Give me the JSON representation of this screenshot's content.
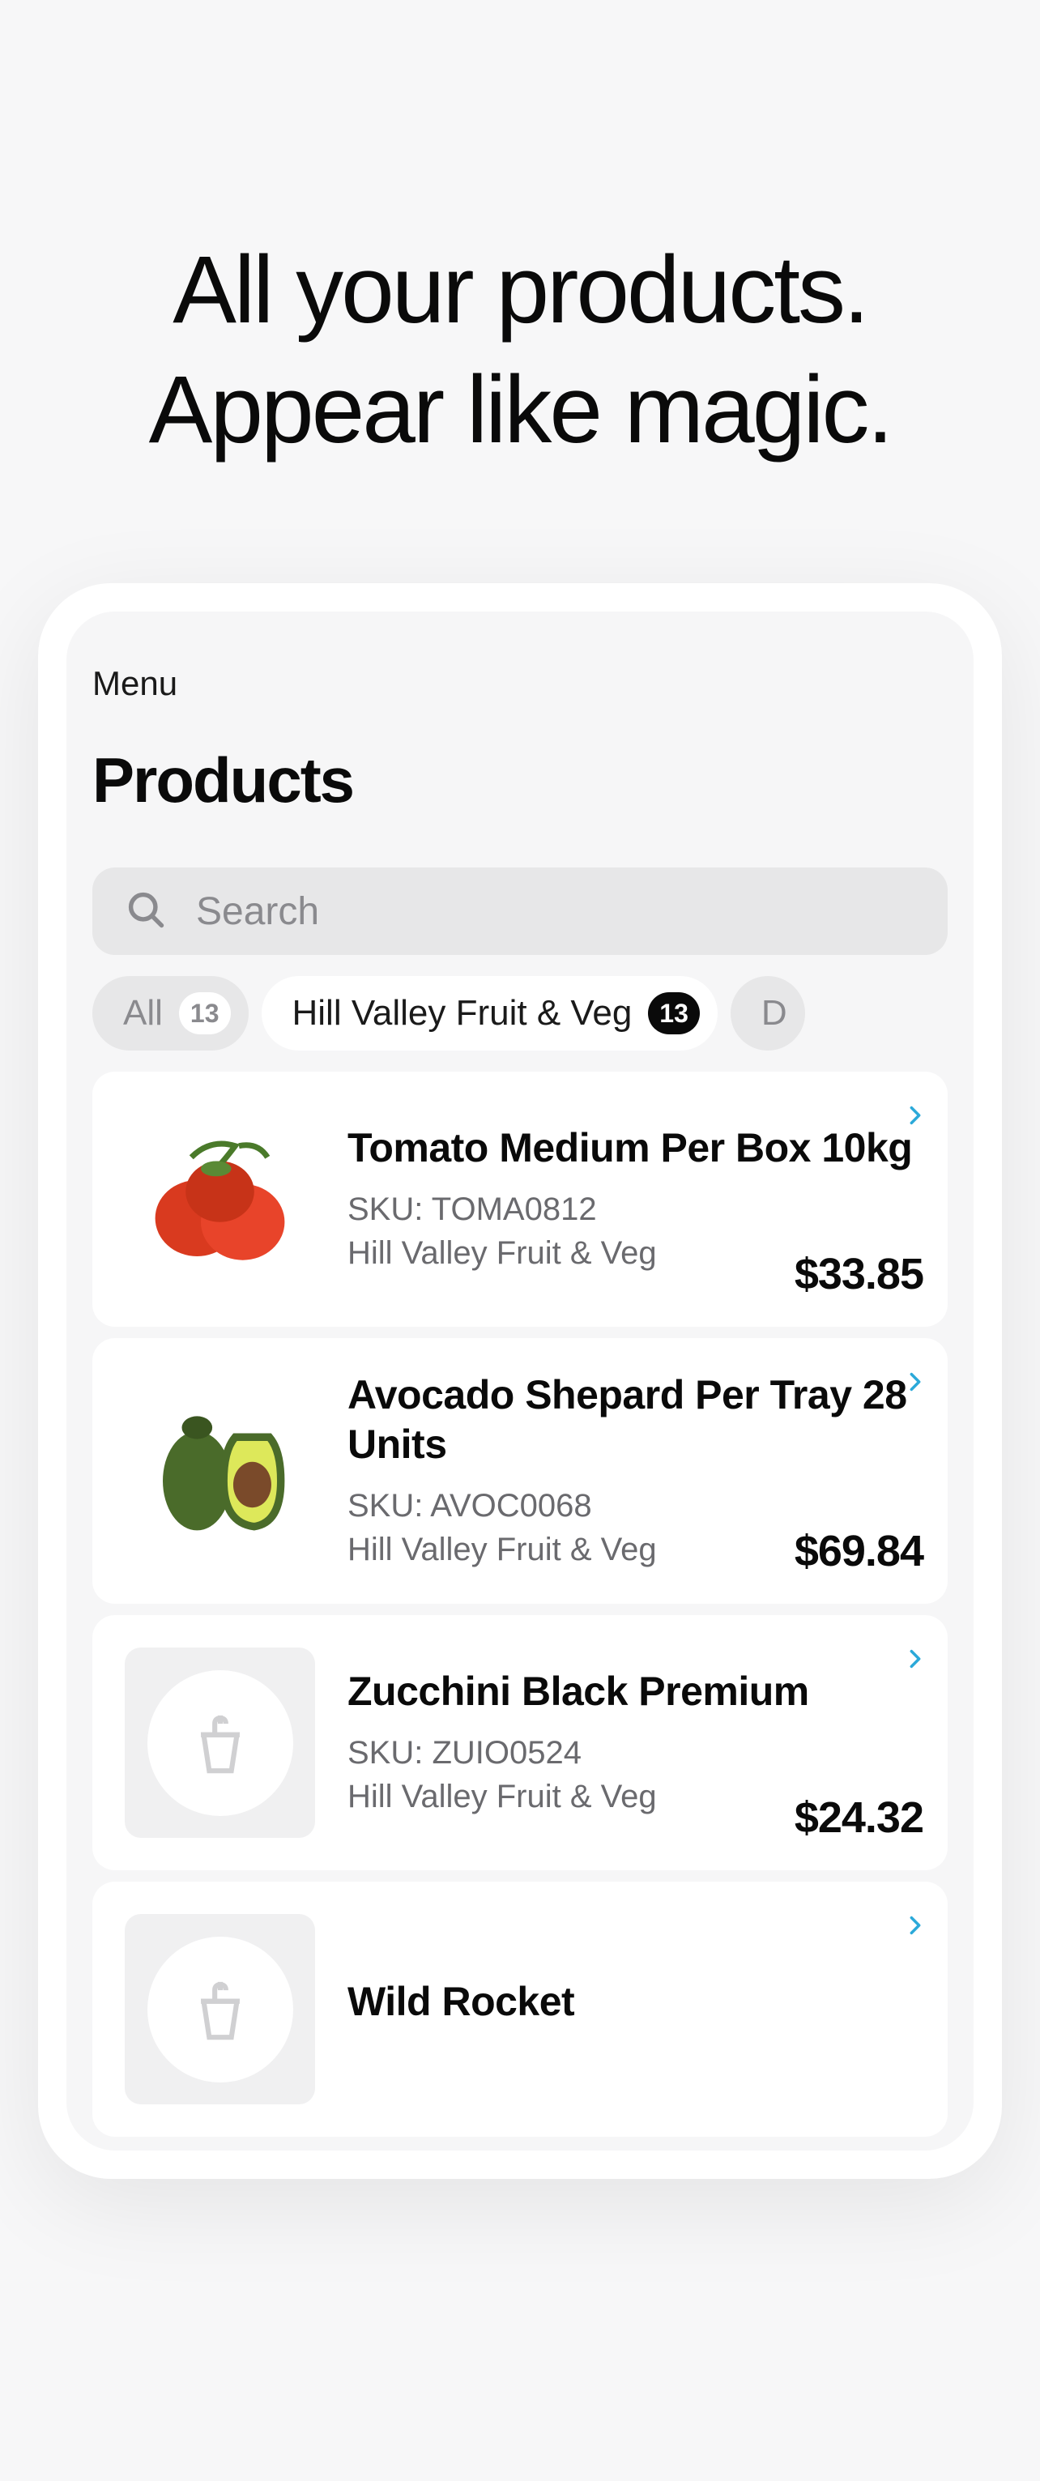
{
  "headline": {
    "line1": "All your products.",
    "line2": "Appear like magic."
  },
  "nav": {
    "menu": "Menu"
  },
  "page": {
    "title": "Products"
  },
  "search": {
    "placeholder": "Search"
  },
  "filters": [
    {
      "label": "All",
      "count": "13",
      "active": false
    },
    {
      "label": "Hill Valley Fruit & Veg",
      "count": "13",
      "active": true
    },
    {
      "label": "D",
      "count": "",
      "active": false
    }
  ],
  "products": [
    {
      "name": "Tomato Medium Per Box 10kg",
      "sku": "SKU: TOMA0812",
      "vendor": "Hill Valley Fruit & Veg",
      "price": "$33.85",
      "image": "tomato"
    },
    {
      "name": "Avocado Shepard Per Tray 28 Units",
      "sku": "SKU: AVOC0068",
      "vendor": "Hill Valley Fruit & Veg",
      "price": "$69.84",
      "image": "avocado"
    },
    {
      "name": "Zucchini Black Premium",
      "sku": "SKU: ZUIO0524",
      "vendor": "Hill Valley Fruit & Veg",
      "price": "$24.32",
      "image": "placeholder"
    },
    {
      "name": "Wild Rocket",
      "sku": "",
      "vendor": "",
      "price": "",
      "image": "placeholder"
    }
  ]
}
